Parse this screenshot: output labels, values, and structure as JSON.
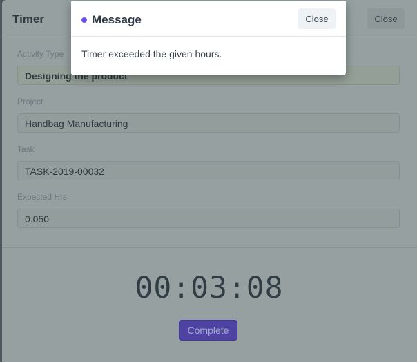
{
  "timer_dialog": {
    "title": "Timer",
    "close_label": "Close",
    "fields": [
      {
        "label": "Activity Type",
        "value": "Designing the product"
      },
      {
        "label": "Project",
        "value": "Handbag Manufacturing"
      },
      {
        "label": "Task",
        "value": "TASK-2019-00032"
      },
      {
        "label": "Expected Hrs",
        "value": "0.050"
      }
    ],
    "clock": "00:03:08",
    "complete_label": "Complete"
  },
  "message_dialog": {
    "indicator_color": "#6c4ef0",
    "title": "Message",
    "close_label": "Close",
    "body": "Timer exceeded the given hours."
  }
}
